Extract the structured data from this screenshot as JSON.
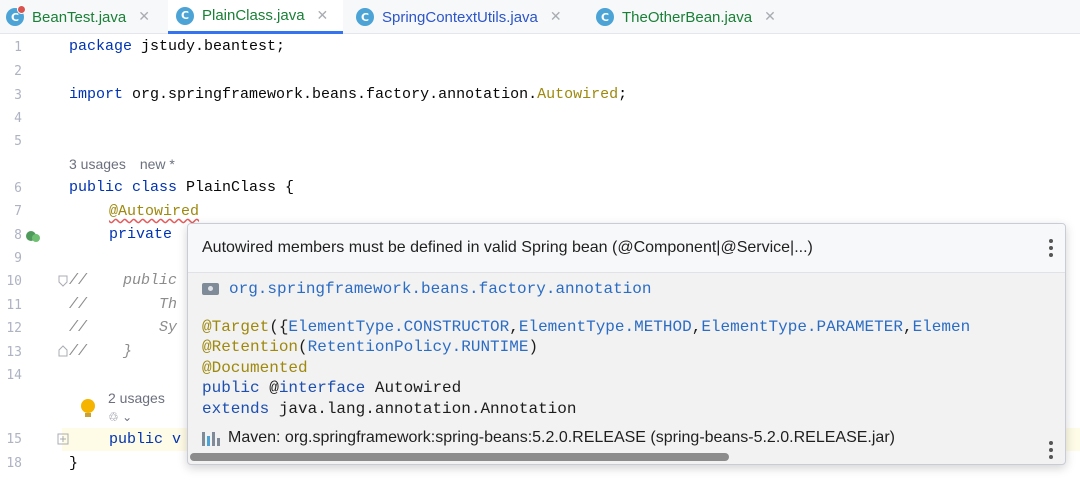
{
  "tabs": [
    {
      "label": "BeanTest.java",
      "icon": "java-class-icon",
      "color": "#1a7f37",
      "active": false
    },
    {
      "label": "PlainClass.java",
      "icon": "java-class-icon",
      "color": "#1a7f37",
      "active": true
    },
    {
      "label": "SpringContextUtils.java",
      "icon": "java-class-icon",
      "color": "#2c55c8",
      "active": false
    },
    {
      "label": "TheOtherBean.java",
      "icon": "java-class-icon",
      "color": "#1a7f37",
      "active": false
    }
  ],
  "tab_icon_letter": "C",
  "tab_close_glyph": "✕",
  "gutter": {
    "line_numbers": [
      "1",
      "2",
      "3",
      "4",
      "5",
      "6",
      "7",
      "8",
      "9",
      "10",
      "11",
      "12",
      "13",
      "14",
      "15",
      "18"
    ]
  },
  "code": {
    "l1_kw": "package",
    "l1_rest": " jstudy.beantest;",
    "l3_kw": "import",
    "l3_rest": " org.springframework.beans.factory.annotation.",
    "l3_ann": "Autowired",
    "l3_end": ";",
    "usages_hint": "3 usages",
    "new_hint": "new *",
    "l6_kw": "public class",
    "l6_rest": " PlainClass {",
    "l7_ann": "@Autowired",
    "l8_kw": "private",
    "l10_cmt": "//    public",
    "l11_cmt": "//        Th",
    "l12_cmt": "//        Sy",
    "l13_cmt": "//    }",
    "usages_hint2": "2 usages",
    "l15_kw": "public v",
    "l18": "}"
  },
  "popup": {
    "title": "Autowired members must be defined in valid Spring bean (@Component|@Service|...)",
    "package": "org.springframework.beans.factory.annotation",
    "target_prefix": "@Target",
    "target_args_open": "({",
    "target_items": [
      "ElementType.CONSTRUCTOR",
      "ElementType.METHOD",
      "ElementType.PARAMETER",
      "Elemen"
    ],
    "retention_prefix": "@Retention",
    "retention_value": "RetentionPolicy.RUNTIME",
    "documented": "@Documented",
    "decl_kw": "public",
    "decl_at": " @",
    "decl_kw2": "interface",
    "decl_name": " Autowired",
    "extends_kw": "extends",
    "extends_name": " java.lang.annotation.Annotation",
    "maven": "Maven: org.springframework:spring-beans:5.2.0.RELEASE (spring-beans-5.2.0.RELEASE.jar)"
  },
  "colors": {
    "accent": "#3574f0",
    "keyword": "#0033b3",
    "annotation": "#9e880d",
    "link": "#2b6cc4"
  }
}
